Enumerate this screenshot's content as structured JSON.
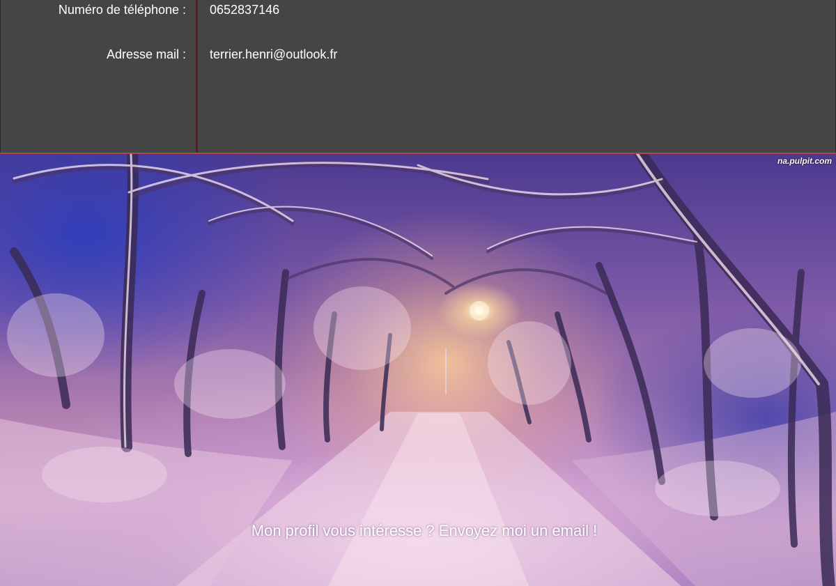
{
  "contact": {
    "phone_label": "Numéro de téléphone :",
    "phone_value": "0652837146",
    "email_label": "Adresse mail :",
    "email_value": "terrier.henri@outlook.fr"
  },
  "banner": {
    "watermark": "na.pulpit.com",
    "cta": "Mon profil vous intéresse ? Envoyez moi un email !"
  },
  "colors": {
    "panel_background": "#454545",
    "divider": "#5a1e1e",
    "text": "#ffffff"
  }
}
